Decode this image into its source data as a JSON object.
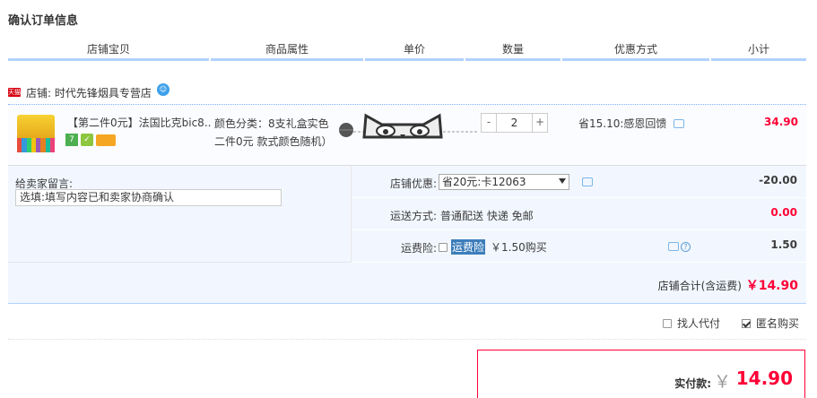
{
  "page": {
    "title": "确认订单信息"
  },
  "columns": [
    "店铺宝贝",
    "商品属性",
    "单价",
    "数量",
    "优惠方式",
    "小计"
  ],
  "shop": {
    "badge": "天猫",
    "name": "店铺: 时代先锋烟具专营店"
  },
  "item": {
    "title": "【第二件0元】法国比克bic8...",
    "attr_line1": "颜色分类：8支礼盒实色",
    "attr_line2": "二件0元 款式颜色随机）",
    "quantity": "2",
    "qty_minus": "-",
    "qty_plus": "+",
    "promo": "省15.10:感恩回馈",
    "subtotal": "34.90",
    "badge_seven": "7"
  },
  "buyer_message": {
    "label": "给卖家留言:",
    "placeholder": "选填:填写内容已和卖家协商确认"
  },
  "shop_discount": {
    "label": "店铺优惠:",
    "selected": "省20元:卡12063",
    "value": "-20.00"
  },
  "shipping": {
    "label": "运送方式:",
    "method": "普通配送 快递 免邮",
    "value": "0.00"
  },
  "insurance": {
    "label": "运费险:",
    "name": "运费险",
    "price": "￥1.50购买",
    "value": "1.50",
    "help": "?"
  },
  "shop_total": {
    "label": "店铺合计(含运费)",
    "amount": "￥14.90"
  },
  "options": {
    "proxy_pay": "找人代付",
    "anonymous": "匿名购买"
  },
  "payment": {
    "label": "实付款:",
    "currency": "￥",
    "amount": "14.90"
  },
  "colors": {
    "accent_red": "#ff0036",
    "border_blue": "#b2d1ff",
    "panel_bg": "#f2f7ff"
  }
}
